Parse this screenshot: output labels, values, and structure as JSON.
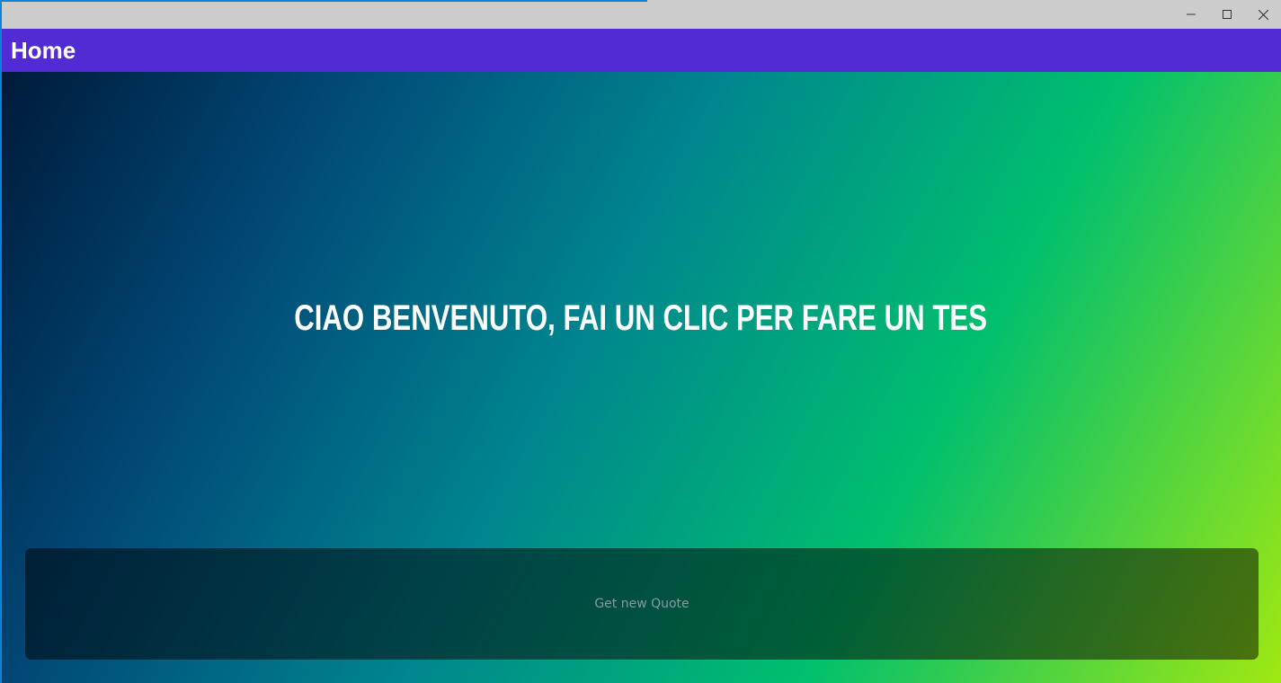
{
  "window": {
    "controls": {
      "minimize_icon": "minimize-icon",
      "maximize_icon": "maximize-icon",
      "close_icon": "close-icon"
    }
  },
  "appbar": {
    "title": "Home",
    "background_color": "#512bd4"
  },
  "main": {
    "headline": "CIAO BENVENUTO, FAI UN CLIC PER FARE UN TES",
    "quote_button_label": "Get new Quote"
  }
}
